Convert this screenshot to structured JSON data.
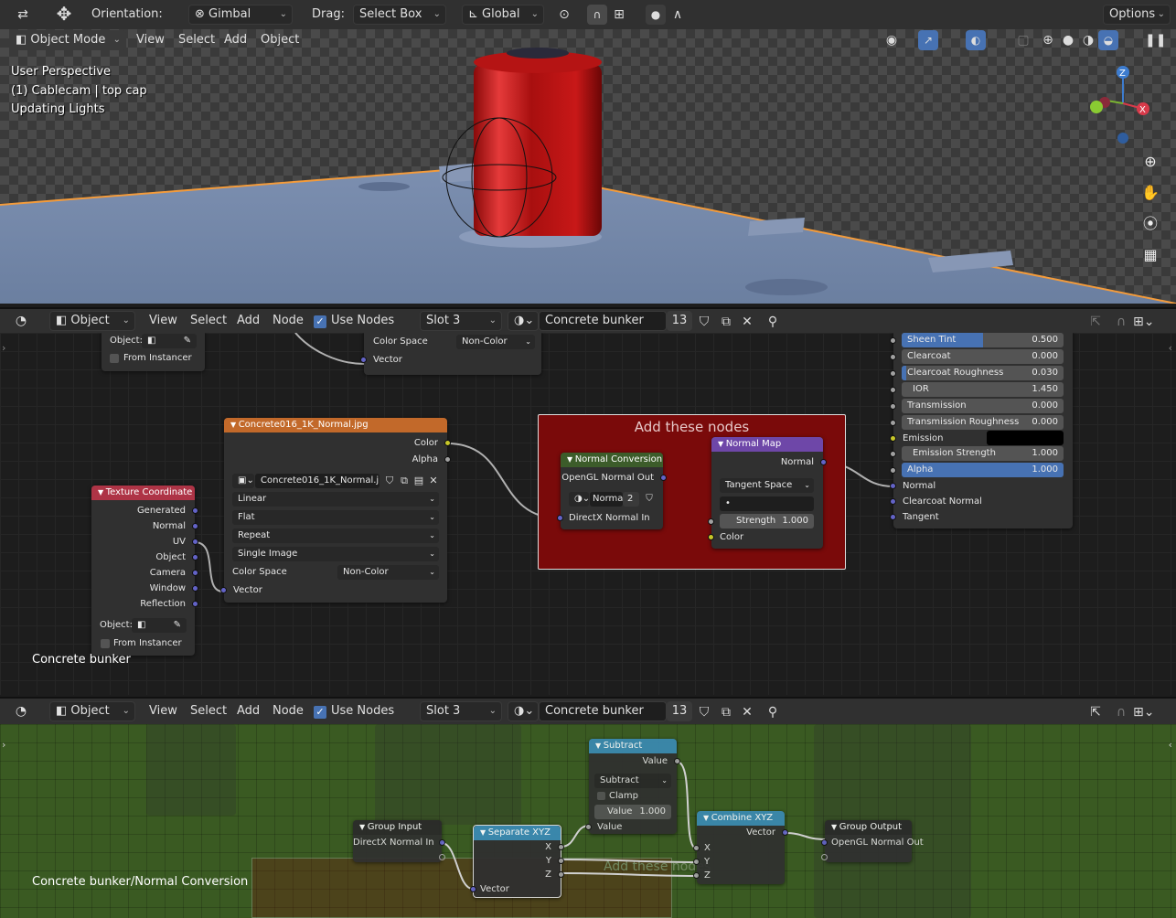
{
  "top_header": {
    "orientation_label": "Orientation:",
    "orientation_value": "Gimbal",
    "drag_label": "Drag:",
    "drag_value": "Select Box",
    "transform_space": "Global",
    "options": "Options"
  },
  "viewport_header": {
    "mode": "Object Mode",
    "menus": [
      "View",
      "Select",
      "Add",
      "Object"
    ]
  },
  "viewport": {
    "overlay_lines": [
      "User Perspective",
      "(1) Cablecam | top cap",
      "Updating Lights"
    ],
    "gizmo": {
      "z": "Z",
      "x": "X"
    }
  },
  "node_editor_1": {
    "object_type": "Object",
    "menus": [
      "View",
      "Select",
      "Add",
      "Node"
    ],
    "use_nodes": "Use Nodes",
    "slot": "Slot 3",
    "material": "Concrete bunker",
    "users": "13",
    "breadcrumb": "Concrete bunker",
    "partial_node_left": {
      "object_label": "Object:",
      "from_instancer": "From Instancer"
    },
    "partial_node_top": {
      "color_space_label": "Color Space",
      "color_space_value": "Non-Color",
      "vector": "Vector"
    },
    "frame_label": "Add these nodes",
    "image_node": {
      "title": "Concrete016_1K_Normal.jpg",
      "out_color": "Color",
      "out_alpha": "Alpha",
      "image_name": "Concrete016_1K_Normal.jpg",
      "interpolation": "Linear",
      "projection": "Flat",
      "extension": "Repeat",
      "source": "Single Image",
      "color_space_label": "Color Space",
      "color_space_value": "Non-Color",
      "in_vector": "Vector"
    },
    "texcoord_node": {
      "title": "Texture Coordinate",
      "outputs": [
        "Generated",
        "Normal",
        "UV",
        "Object",
        "Camera",
        "Window",
        "Reflection"
      ],
      "object_label": "Object:",
      "from_instancer": "From Instancer"
    },
    "normal_conversion_node": {
      "title": "Normal Conversion",
      "out": "OpenGL Normal Out",
      "group_name": "Norma",
      "group_users": "2",
      "in": "DirectX Normal In"
    },
    "normal_map_node": {
      "title": "Normal Map",
      "out": "Normal",
      "space": "Tangent Space",
      "uv_value": "•",
      "strength_label": "Strength",
      "strength_value": "1.000",
      "in_color": "Color"
    },
    "bsdf_partial": {
      "rows": [
        {
          "label": "Sheen Tint",
          "value": "0.500",
          "fill": 0.5
        },
        {
          "label": "Clearcoat",
          "value": "0.000",
          "fill": 0
        },
        {
          "label": "Clearcoat Roughness",
          "value": "0.030",
          "fill": 0.03
        },
        {
          "label": "IOR",
          "value": "1.450",
          "fill": 0
        },
        {
          "label": "Transmission",
          "value": "0.000",
          "fill": 0
        },
        {
          "label": "Transmission Roughness",
          "value": "0.000",
          "fill": 0
        }
      ],
      "emission": "Emission",
      "emission_color": "#000000",
      "emission_strength_label": "Emission Strength",
      "emission_strength_value": "1.000",
      "alpha_label": "Alpha",
      "alpha_value": "1.000",
      "alpha_fill": 1.0,
      "inputs": [
        "Normal",
        "Clearcoat Normal",
        "Tangent"
      ]
    }
  },
  "node_editor_2": {
    "object_type": "Object",
    "menus": [
      "View",
      "Select",
      "Add",
      "Node"
    ],
    "use_nodes": "Use Nodes",
    "slot": "Slot 3",
    "material": "Concrete bunker",
    "users": "13",
    "breadcrumb": "Concrete bunker/Normal Conversion",
    "subtract_node": {
      "title": "Subtract",
      "out": "Value",
      "op": "Subtract",
      "clamp": "Clamp",
      "value_label": "Value",
      "value": "1.000",
      "in": "Value"
    },
    "group_input_node": {
      "title": "Group Input",
      "out": "DirectX Normal In"
    },
    "separate_node": {
      "title": "Separate XYZ",
      "outs": [
        "X",
        "Y",
        "Z"
      ],
      "in": "Vector"
    },
    "combine_node": {
      "title": "Combine XYZ",
      "out": "Vector",
      "ins": [
        "X",
        "Y",
        "Z"
      ]
    },
    "group_output_node": {
      "title": "Group Output",
      "in": "OpenGL Normal Out"
    },
    "ghost_frame_label": "Add these nodes"
  },
  "colors": {
    "accent_blue": "#4772b3",
    "image_header": "#c2692a",
    "texcoord_header": "#ae3446",
    "group_header": "#3c5c2a",
    "vector_header": "#6e47a8",
    "converter_header": "#3b8ab3",
    "frame_red": "#7a0a0a",
    "socket_yellow": "#c7c729",
    "socket_gray": "#a1a1a1",
    "socket_purple": "#6363c7"
  }
}
